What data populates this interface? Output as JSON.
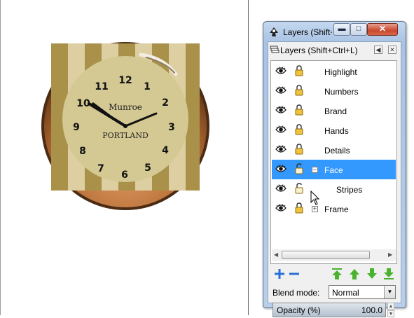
{
  "window": {
    "title": "Layers (Shift+Ctrl+L)",
    "minimize_icon": "minimize-icon",
    "maximize_icon": "maximize-icon",
    "close_icon": "close-icon"
  },
  "dock": {
    "title": "Layers (Shift+Ctrl+L)",
    "menu_icon": "dock-menu-icon",
    "close_icon": "dock-close-icon"
  },
  "layers": [
    {
      "name": "Highlight",
      "visible": true,
      "locked": true,
      "selected": false,
      "expander": "",
      "level": 0
    },
    {
      "name": "Numbers",
      "visible": true,
      "locked": true,
      "selected": false,
      "expander": "",
      "level": 0
    },
    {
      "name": "Brand",
      "visible": true,
      "locked": true,
      "selected": false,
      "expander": "",
      "level": 0
    },
    {
      "name": "Hands",
      "visible": true,
      "locked": true,
      "selected": false,
      "expander": "",
      "level": 0
    },
    {
      "name": "Details",
      "visible": true,
      "locked": true,
      "selected": false,
      "expander": "",
      "level": 0
    },
    {
      "name": "Face",
      "visible": true,
      "locked": false,
      "selected": true,
      "expander": "−",
      "level": 0
    },
    {
      "name": "Stripes",
      "visible": true,
      "locked": false,
      "selected": false,
      "expander": "",
      "level": 1
    },
    {
      "name": "Frame",
      "visible": true,
      "locked": true,
      "selected": false,
      "expander": "+",
      "level": 0
    }
  ],
  "toolbar": [
    {
      "name": "add-layer-button",
      "icon": "plus-icon",
      "color": "#2a6fd6"
    },
    {
      "name": "remove-layer-button",
      "icon": "minus-icon",
      "color": "#2a6fd6"
    },
    {
      "name": "raise-to-top-button",
      "icon": "arrow-top-icon",
      "color": "#49b22f"
    },
    {
      "name": "raise-layer-button",
      "icon": "arrow-up-icon",
      "color": "#49b22f"
    },
    {
      "name": "lower-layer-button",
      "icon": "arrow-down-icon",
      "color": "#49b22f"
    },
    {
      "name": "lower-to-bottom-button",
      "icon": "arrow-bottom-icon",
      "color": "#49b22f"
    }
  ],
  "blend": {
    "label": "Blend mode:",
    "value": "Normal"
  },
  "opacity": {
    "label": "Opacity (%)",
    "value": "100.0"
  },
  "clock": {
    "brand_top": "Munroe",
    "brand_bottom": "PORTLAND",
    "numerals": [
      "12",
      "1",
      "2",
      "3",
      "4",
      "5",
      "6",
      "7",
      "8",
      "9",
      "10",
      "11"
    ]
  },
  "colors": {
    "selection": "#3399ff",
    "stripe_dark": "#a9914a",
    "stripe_light": "#ddcfa1",
    "face": "#d4c893",
    "frame": "#b9763c"
  }
}
